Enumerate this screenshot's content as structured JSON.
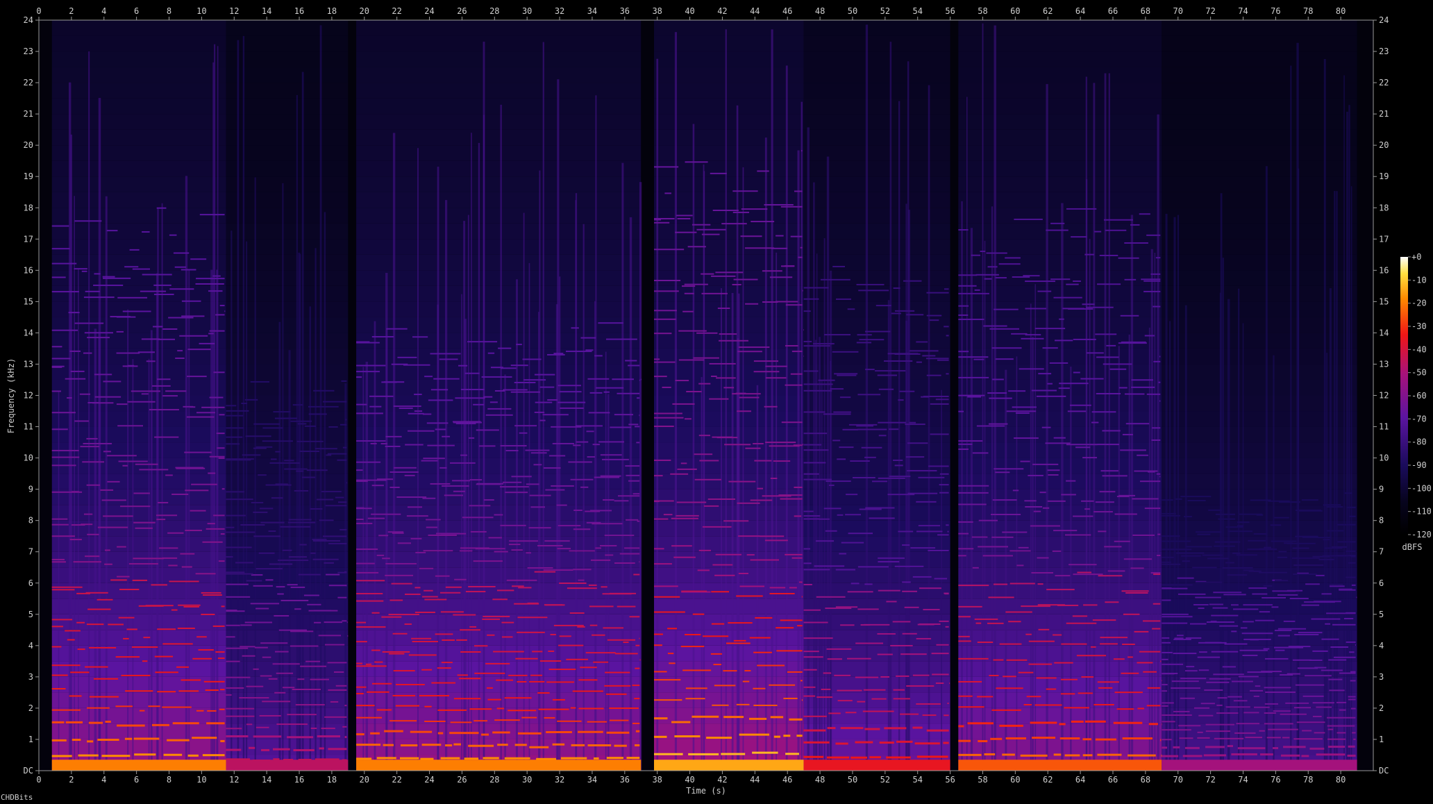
{
  "chart_data": {
    "type": "heatmap",
    "title": "",
    "xlabel": "Time (s)",
    "ylabel": "Frequency (kHz)",
    "xlim": [
      0,
      82
    ],
    "ylim": [
      0,
      24
    ],
    "x_ticks": [
      "0",
      "2",
      "4",
      "6",
      "8",
      "10",
      "12",
      "14",
      "16",
      "18",
      "20",
      "22",
      "24",
      "26",
      "28",
      "30",
      "32",
      "34",
      "36",
      "38",
      "40",
      "42",
      "44",
      "46",
      "48",
      "50",
      "52",
      "54",
      "56",
      "58",
      "60",
      "62",
      "64",
      "66",
      "68",
      "70",
      "72",
      "74",
      "76",
      "78",
      "80"
    ],
    "y_ticks": [
      "DC",
      "1",
      "2",
      "3",
      "4",
      "5",
      "6",
      "7",
      "8",
      "9",
      "10",
      "11",
      "12",
      "13",
      "14",
      "15",
      "16",
      "17",
      "18",
      "19",
      "20",
      "21",
      "22",
      "23",
      "24"
    ],
    "colorbar": {
      "label": "dBFS",
      "ticks": [
        "+0",
        "-10",
        "-20",
        "-30",
        "-40",
        "-50",
        "-60",
        "-70",
        "-80",
        "-90",
        "-100",
        "-110",
        "-120"
      ],
      "range": [
        -120,
        0
      ]
    },
    "loud_segments": [
      {
        "t0": 0.8,
        "t1": 11.5,
        "f0": 0.5,
        "level": 0.95
      },
      {
        "t0": 11.5,
        "t1": 19.0,
        "f0": 0.35,
        "level": 0.7
      },
      {
        "t0": 19.5,
        "t1": 37.0,
        "f0": 0.4,
        "level": 0.95
      },
      {
        "t0": 37.8,
        "t1": 47.0,
        "f0": 0.55,
        "level": 1.0
      },
      {
        "t0": 47.0,
        "t1": 56.0,
        "f0": 0.45,
        "level": 0.8
      },
      {
        "t0": 56.5,
        "t1": 69.0,
        "f0": 0.5,
        "level": 0.9
      },
      {
        "t0": 69.0,
        "t1": 81.0,
        "f0": 0.25,
        "level": 0.65
      }
    ]
  },
  "footer": {
    "text": "CHDBits"
  },
  "colors": {
    "background": "#000000",
    "axis": "#a0a0a0"
  }
}
